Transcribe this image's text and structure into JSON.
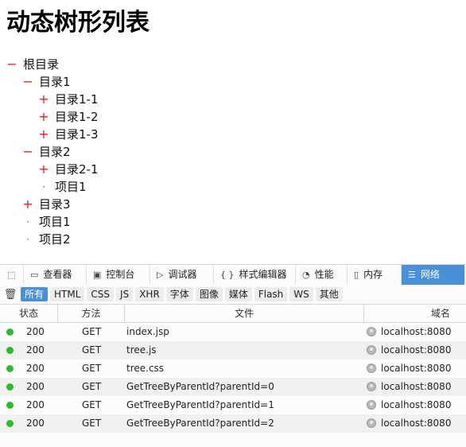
{
  "page": {
    "title": "动态树形列表"
  },
  "tree": [
    {
      "level": 0,
      "toggle": "−",
      "label": "根目录"
    },
    {
      "level": 1,
      "toggle": "−",
      "label": "目录1"
    },
    {
      "level": 2,
      "toggle": "+",
      "label": "目录1-1"
    },
    {
      "level": 2,
      "toggle": "+",
      "label": "目录1-2"
    },
    {
      "level": 2,
      "toggle": "+",
      "label": "目录1-3"
    },
    {
      "level": 1,
      "toggle": "−",
      "label": "目录2"
    },
    {
      "level": 2,
      "toggle": "+",
      "label": "目录2-1"
    },
    {
      "level": 2,
      "toggle": "·",
      "label": "项目1"
    },
    {
      "level": 1,
      "toggle": "+",
      "label": "目录3"
    },
    {
      "level": 1,
      "toggle": "·",
      "label": "项目1"
    },
    {
      "level": 1,
      "toggle": "·",
      "label": "项目2"
    }
  ],
  "devtools": {
    "tabs": [
      {
        "name": "inspector",
        "icon": "inspector-icon",
        "glyph": "▭",
        "label": "查看器",
        "active": false
      },
      {
        "name": "console",
        "icon": "console-icon",
        "glyph": "▣",
        "label": "控制台",
        "active": false
      },
      {
        "name": "debugger",
        "icon": "debugger-icon",
        "glyph": "▷",
        "label": "调试器",
        "active": false
      },
      {
        "name": "style-editor",
        "icon": "braces-icon",
        "glyph": "{ }",
        "label": "样式编辑器",
        "active": false
      },
      {
        "name": "performance",
        "icon": "gauge-icon",
        "glyph": "◔",
        "label": "性能",
        "active": false
      },
      {
        "name": "memory",
        "icon": "memory-chip-icon",
        "glyph": "▯",
        "label": "内存",
        "active": false
      },
      {
        "name": "network",
        "icon": "network-icon",
        "glyph": "☰",
        "label": "网络",
        "active": true
      }
    ],
    "filters": [
      {
        "label": "所有",
        "active": true
      },
      {
        "label": "HTML",
        "active": false
      },
      {
        "label": "CSS",
        "active": false
      },
      {
        "label": "JS",
        "active": false
      },
      {
        "label": "XHR",
        "active": false
      },
      {
        "label": "字体",
        "active": false
      },
      {
        "label": "图像",
        "active": false
      },
      {
        "label": "媒体",
        "active": false
      },
      {
        "label": "Flash",
        "active": false
      },
      {
        "label": "WS",
        "active": false
      },
      {
        "label": "其他",
        "active": false
      }
    ],
    "columns": {
      "status": "状态",
      "method": "方法",
      "file": "文件",
      "domain": "域名"
    },
    "requests": [
      {
        "status": "200",
        "method": "GET",
        "file": "index.jsp",
        "domain": "localhost:8080"
      },
      {
        "status": "200",
        "method": "GET",
        "file": "tree.js",
        "domain": "localhost:8080"
      },
      {
        "status": "200",
        "method": "GET",
        "file": "tree.css",
        "domain": "localhost:8080"
      },
      {
        "status": "200",
        "method": "GET",
        "file": "GetTreeByParentId?parentId=0",
        "domain": "localhost:8080"
      },
      {
        "status": "200",
        "method": "GET",
        "file": "GetTreeByParentId?parentId=1",
        "domain": "localhost:8080"
      },
      {
        "status": "200",
        "method": "GET",
        "file": "GetTreeByParentId?parentId=2",
        "domain": "localhost:8080"
      }
    ],
    "colors": {
      "accent": "#4a90d9",
      "status_ok": "#2cbb2c",
      "toggle": "#e02020"
    }
  }
}
